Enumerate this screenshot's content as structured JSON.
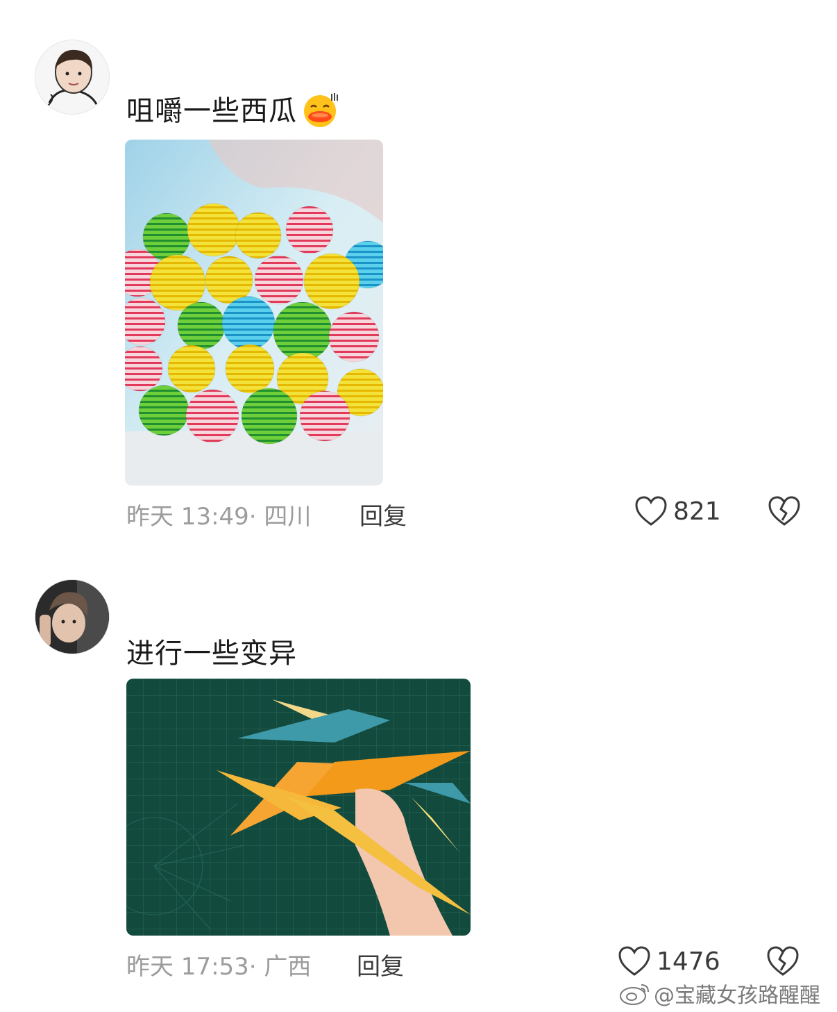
{
  "comments": [
    {
      "text": "咀嚼一些西瓜",
      "emoji": "laughing-duck-emoji",
      "meta": "昨天 13:49· 四川",
      "reply_label": "回复",
      "likes": "821",
      "image": "watermelon-gumballs-photo"
    },
    {
      "text": "进行一些变异",
      "meta": "昨天 17:53· 广西",
      "reply_label": "回复",
      "likes": "1476",
      "image": "origami-claws-photo"
    }
  ],
  "watermark": {
    "text": "@宝藏女孩路醒醒",
    "icon": "weibo-icon"
  },
  "colors": {
    "text": "#1a1a1a",
    "meta": "#9c9c9c",
    "action": "#3a3a3a",
    "background": "#ffffff"
  }
}
